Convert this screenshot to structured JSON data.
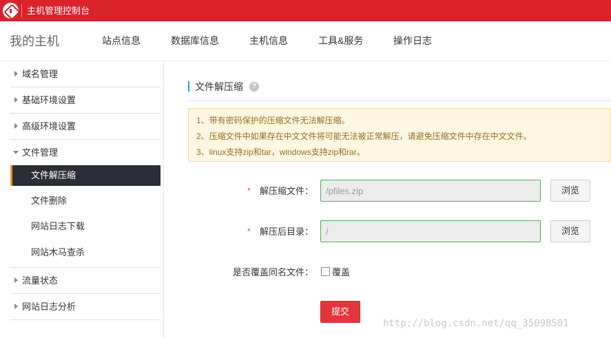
{
  "app": {
    "title": "主机管理控制台"
  },
  "navbar": {
    "brand": "我的主机",
    "items": [
      {
        "label": "站点信息"
      },
      {
        "label": "数据库信息"
      },
      {
        "label": "主机信息"
      },
      {
        "label": "工具&服务"
      },
      {
        "label": "操作日志"
      }
    ]
  },
  "sidebar": {
    "groups": [
      {
        "label": "域名管理",
        "expanded": false
      },
      {
        "label": "基础环境设置",
        "expanded": false
      },
      {
        "label": "高级环境设置",
        "expanded": false
      },
      {
        "label": "文件管理",
        "expanded": true
      },
      {
        "label": "流量状态",
        "expanded": false
      },
      {
        "label": "网站日志分析",
        "expanded": false
      }
    ],
    "file_submenu": [
      {
        "label": "文件解压缩",
        "active": true
      },
      {
        "label": "文件删除",
        "active": false
      },
      {
        "label": "网站日志下载",
        "active": false
      },
      {
        "label": "网站木马查杀",
        "active": false
      }
    ]
  },
  "main": {
    "section_title": "文件解压缩",
    "help_icon": "?",
    "notices": [
      "1、带有密码保护的压缩文件无法解压缩。",
      "2、压缩文件中如果存在中文文件将可能无法被正常解压，请避免压缩文件中存在中文文件。",
      "3、linux支持zip和tar，windows支持zip和rar。"
    ],
    "form": {
      "required_mark": "*",
      "archive_label": "解压缩文件：",
      "archive_value": "/pfiles.zip",
      "target_label": "解压后目录：",
      "target_value": "/",
      "browse_label": "浏览",
      "overwrite_label": "是否覆盖同名文件：",
      "overwrite_option": "覆盖",
      "overwrite_checked": false,
      "submit_label": "提交"
    }
  },
  "watermark": "http://blog.csdn.net/qq_35098501",
  "colors": {
    "brand_red": "#d9222a",
    "active_menu_bg": "#2b2e36",
    "active_menu_accent": "#e59a1b",
    "notice_bg": "#fef7e1",
    "notice_text": "#996d21",
    "input_border": "#4cae4c",
    "submit_bg": "#e3353c"
  },
  "icons": {
    "logo": "brand-logo-icon",
    "collapsed": "caret-right-icon",
    "expanded": "caret-down-icon",
    "help": "help-icon"
  }
}
